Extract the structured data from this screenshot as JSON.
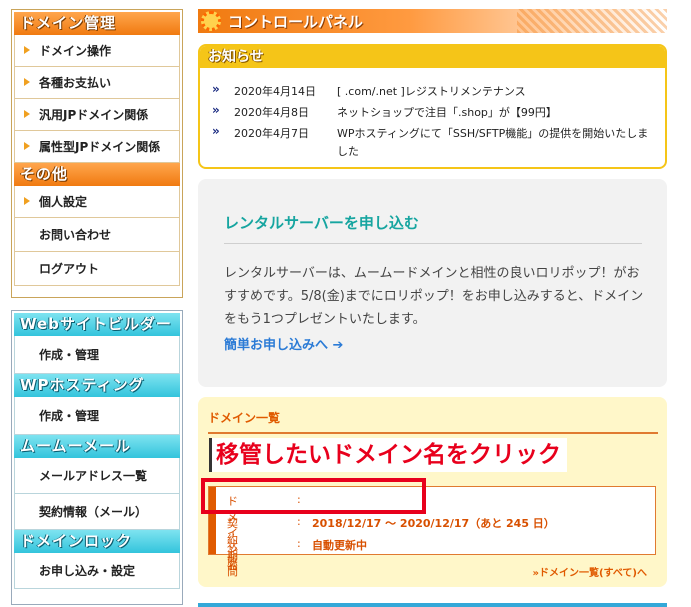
{
  "nav_primary": {
    "sections": [
      {
        "title": "ドメイン管理",
        "items": [
          {
            "label": "ドメイン操作",
            "arrow": true
          },
          {
            "label": "各種お支払い",
            "arrow": true
          },
          {
            "label": "汎用JPドメイン関係",
            "arrow": true
          },
          {
            "label": "属性型JPドメイン関係",
            "arrow": true
          }
        ]
      },
      {
        "title": "その他",
        "items": [
          {
            "label": "個人設定",
            "arrow": true
          },
          {
            "label": "お問い合わせ",
            "arrow": false
          },
          {
            "label": "ログアウト",
            "arrow": false
          }
        ]
      }
    ]
  },
  "nav_services": {
    "sections": [
      {
        "title": "Webサイトビルダー",
        "items": [
          {
            "label": "作成・管理"
          }
        ]
      },
      {
        "title": "WPホスティング",
        "items": [
          {
            "label": "作成・管理"
          }
        ]
      },
      {
        "title": "ムームーメール",
        "items": [
          {
            "label": "メールアドレス一覧"
          },
          {
            "label": "契約情報（メール）"
          }
        ]
      },
      {
        "title": "ドメインロック",
        "items": [
          {
            "label": "お申し込み・設定"
          }
        ]
      }
    ]
  },
  "header": {
    "title": "コントロールパネル"
  },
  "notice": {
    "title": "お知らせ",
    "items": [
      {
        "date": "2020年4月14日",
        "text": "[ .com/.net ]レジストリメンテナンス"
      },
      {
        "date": "2020年4月8日",
        "text": "ネットショップで注目「.shop」が【99円】"
      },
      {
        "date": "2020年4月7日",
        "text": "WPホスティングにて「SSH/SFTP機能」の提供を開始いたしました"
      }
    ]
  },
  "rental": {
    "title": "レンタルサーバーを申し込む",
    "body": "レンタルサーバーは、ムームードメインと相性の良いロリポップ！がおすすめです。5/8(金)までにロリポップ！をお申し込みすると、ドメインをもう1つプレゼントいたします。",
    "link": "簡単お申し込みへ ➔"
  },
  "domains": {
    "title": "ドメイン一覧",
    "instruction": "移管したいドメイン名をクリック",
    "rows": [
      {
        "label": "ドメイン名",
        "colon": ":",
        "value": ""
      },
      {
        "label": "契約期間",
        "colon": ":",
        "value": "2018/12/17 〜 2020/12/17（あと 245 日）"
      },
      {
        "label": "状態",
        "colon": ":",
        "value": "自動更新中"
      }
    ],
    "all_link": "»ドメイン一覧(すべて)へ"
  },
  "colors": {
    "accent_orange": "#f07a10",
    "accent_cyan": "#33c4dc",
    "notice_yellow": "#f5c518",
    "highlight_red": "#e8001c",
    "rental_teal": "#16a5a0"
  }
}
